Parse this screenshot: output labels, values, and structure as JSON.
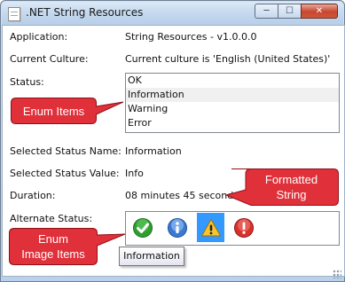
{
  "window": {
    "title": ".NET String Resources",
    "minimize_glyph": "─",
    "maximize_glyph": "☐",
    "close_glyph": "✕"
  },
  "fields": {
    "application_label": "Application:",
    "application_value": "String Resources - v1.0.0.0",
    "culture_label": "Current Culture:",
    "culture_value": "Current culture is 'English (United States)'",
    "status_label": "Status:",
    "selected_name_label": "Selected Status Name:",
    "selected_name_value": "Information",
    "selected_value_label": "Selected Status Value:",
    "selected_value_value": "Info",
    "duration_label": "Duration:",
    "duration_value": "08 minutes 45 seconds",
    "alternate_label": "Alternate Status:"
  },
  "status_list": {
    "items": [
      "OK",
      "Information",
      "Warning",
      "Error"
    ],
    "selected_index": 1
  },
  "alternate_status": {
    "icons": [
      "check-icon",
      "info-icon",
      "warning-icon",
      "error-icon"
    ],
    "selected_index": 2,
    "tooltip": "Information"
  },
  "callouts": {
    "enum_items": "Enum Items",
    "formatted_string_line1": "Formatted",
    "formatted_string_line2": "String",
    "enum_image_line1": "Enum",
    "enum_image_line2": "Image Items"
  },
  "colors": {
    "callout_fill": "#e0303a",
    "callout_border": "#8f1017",
    "selection": "#3399ff"
  }
}
